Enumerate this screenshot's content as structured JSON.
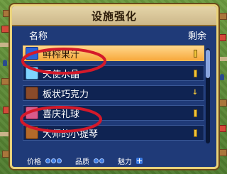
{
  "window": {
    "title": "设施强化"
  },
  "list_header": {
    "name_label": "名称",
    "remaining_label": "剩余"
  },
  "items": [
    {
      "name": "鲜榨果汁",
      "icon": "juice-cup-icon",
      "icon_color": "#2a63d8",
      "selected": true,
      "badge": ""
    },
    {
      "name": "天使水晶",
      "icon": "crystal-icon",
      "icon_color": "#7fd4ff",
      "selected": false,
      "badge": ""
    },
    {
      "name": "板状巧克力",
      "icon": "chocolate-icon",
      "icon_color": "#8a4b2a",
      "selected": false,
      "badge": "↓"
    },
    {
      "name": "喜庆礼球",
      "icon": "party-ball-icon",
      "icon_color": "#d95b8a",
      "selected": false,
      "badge": ""
    },
    {
      "name": "大师的小提琴",
      "icon": "violin-icon",
      "icon_color": "#b46a2a",
      "selected": false,
      "badge": ""
    }
  ],
  "footer": {
    "price_label": "价格",
    "price_level": 3,
    "quality_label": "品质",
    "quality_level": 2,
    "charm_label": "魅力",
    "charm_level": 1
  },
  "colors": {
    "panel_bg": "#1f3a78",
    "panel_border": "#e9d27a",
    "selected_row": "#f7a93d",
    "pip": "#3c7ae0",
    "annotation": "#d4192a"
  }
}
